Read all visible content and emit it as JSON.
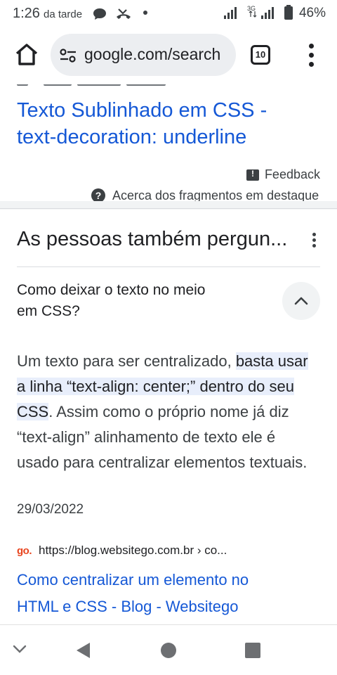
{
  "status_bar": {
    "time": "1:26",
    "time_suffix": "da tarde",
    "network_type": "3G",
    "battery": "46%",
    "icons": [
      "message-icon",
      "missed-call-icon",
      "dot-icon",
      "signal-icon",
      "signal-3g-icon",
      "battery-icon"
    ]
  },
  "browser": {
    "url": "google.com/search",
    "tab_count": "10"
  },
  "snippet": {
    "title_lines": [
      "Texto Sublinhado em CSS -",
      "text-decoration: underline"
    ],
    "feedback_label": "Feedback",
    "about_label": "Acerca dos fragmentos em destaque"
  },
  "paa": {
    "title": "As pessoas também pergun...",
    "question_lines": [
      "Como deixar o texto no meio",
      "em CSS?"
    ],
    "answer": {
      "part1": "Um texto para ser centralizado, ",
      "highlight": "basta usar a linha “text-align: center;” dentro do seu CSS",
      "part2": ". Assim como o próprio nome já diz “text-align” alinhamento de texto ele é usado para centralizar elementos textuais."
    },
    "date": "29/03/2022",
    "source": {
      "logo_text": "go.",
      "url": "https://blog.websitego.com.br › co...",
      "title_lines": [
        "Como centralizar um elemento no",
        "HTML e CSS - Blog - Websitego"
      ]
    }
  },
  "colors": {
    "link": "#1558d6",
    "highlight": "#e8eefb",
    "pill": "#eceef1",
    "brand_orange": "#e8451f"
  }
}
